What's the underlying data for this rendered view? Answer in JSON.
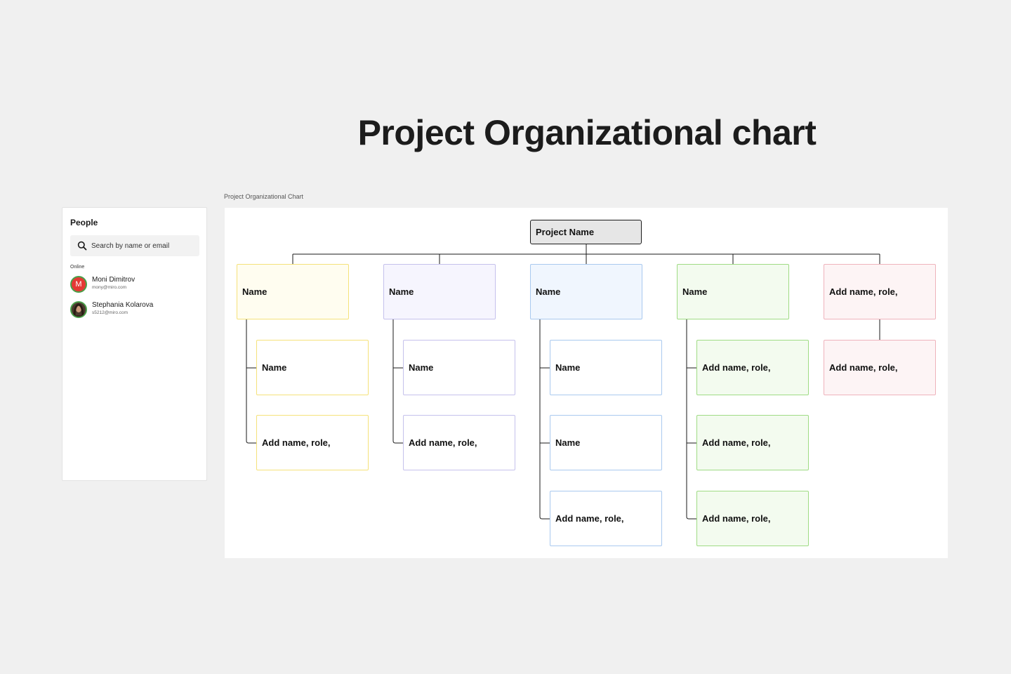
{
  "page": {
    "title": "Project Organizational chart",
    "frame_label": "Project Organizational Chart"
  },
  "people_panel": {
    "title": "People",
    "search_placeholder": "Search by name or email",
    "section_label": "Online",
    "users": [
      {
        "name": "Moni Dimitrov",
        "email": "mony@miro.com",
        "initial": "M"
      },
      {
        "name": "Stephania Kolarova",
        "email": "s5212@miro.com"
      }
    ]
  },
  "org_chart": {
    "root": {
      "label": "Project Name"
    },
    "branches": [
      {
        "color": "yellow",
        "head": "Name",
        "children": [
          "Name",
          "Add name, role,"
        ]
      },
      {
        "color": "purple",
        "head": "Name",
        "children": [
          "Name",
          "Add name, role,"
        ]
      },
      {
        "color": "blue",
        "head": "Name",
        "children": [
          "Name",
          "Name",
          "Add name, role,"
        ]
      },
      {
        "color": "green",
        "head": "Name",
        "children": [
          "Add name, role,",
          "Add name, role,",
          "Add name, role,"
        ]
      },
      {
        "color": "pink",
        "head": "Add name, role,",
        "children": [
          "Add name, role,"
        ]
      }
    ]
  },
  "colors": {
    "background": "#f0f0f0",
    "yellow_border": "#f5e27a",
    "purple_border": "#c5c1ec",
    "blue_border": "#a9c9ef",
    "green_border": "#9fdb84",
    "pink_border": "#efb3bc",
    "connector": "#1a1a1a"
  }
}
